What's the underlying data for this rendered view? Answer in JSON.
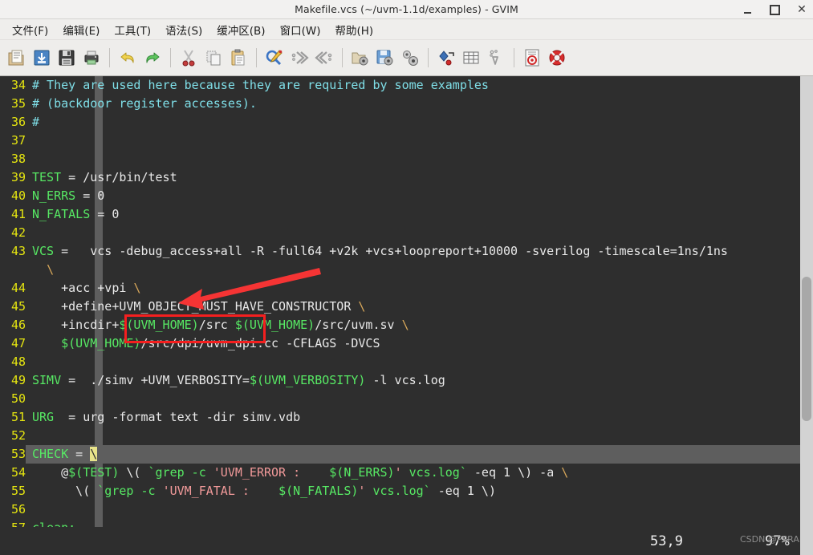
{
  "window": {
    "title": "Makefile.vcs (~/uvm-1.1d/examples) - GVIM",
    "minimize_label": "",
    "maximize_label": "",
    "close_label": "✕"
  },
  "menubar": {
    "items": [
      {
        "label": "文件(F)",
        "name": "menu-file"
      },
      {
        "label": "编辑(E)",
        "name": "menu-edit"
      },
      {
        "label": "工具(T)",
        "name": "menu-tools"
      },
      {
        "label": "语法(S)",
        "name": "menu-syntax"
      },
      {
        "label": "缓冲区(B)",
        "name": "menu-buffers"
      },
      {
        "label": "窗口(W)",
        "name": "menu-window"
      },
      {
        "label": "帮助(H)",
        "name": "menu-help"
      }
    ]
  },
  "toolbar": {
    "buttons": [
      {
        "name": "open-file-icon",
        "tip": "Open"
      },
      {
        "name": "save-file-icon",
        "tip": "Save"
      },
      {
        "name": "save-all-icon",
        "tip": "Save All"
      },
      {
        "name": "print-icon",
        "tip": "Print"
      },
      {
        "name": "undo-icon",
        "tip": "Undo"
      },
      {
        "name": "redo-icon",
        "tip": "Redo"
      },
      {
        "name": "cut-icon",
        "tip": "Cut"
      },
      {
        "name": "copy-icon",
        "tip": "Copy"
      },
      {
        "name": "paste-icon",
        "tip": "Paste"
      },
      {
        "name": "find-icon",
        "tip": "Find"
      },
      {
        "name": "find-next-icon",
        "tip": "Find Next"
      },
      {
        "name": "find-prev-icon",
        "tip": "Find Previous"
      },
      {
        "name": "load-session-icon",
        "tip": "Load Session"
      },
      {
        "name": "save-session-icon",
        "tip": "Save Session"
      },
      {
        "name": "run-script-icon",
        "tip": "Run Script"
      },
      {
        "name": "make-icon",
        "tip": "Make"
      },
      {
        "name": "build-tags-icon",
        "tip": "Build Tags"
      },
      {
        "name": "jump-tag-icon",
        "tip": "Jump to Tag"
      },
      {
        "name": "help-icon",
        "tip": "Help"
      },
      {
        "name": "find-help-icon",
        "tip": "Find Help"
      }
    ]
  },
  "editor": {
    "lines": [
      {
        "no": "34",
        "segs": [
          {
            "t": "# They are used here because they are required by some examples",
            "c": "c-comment"
          }
        ]
      },
      {
        "no": "35",
        "segs": [
          {
            "t": "# (backdoor register accesses).",
            "c": "c-comment"
          }
        ]
      },
      {
        "no": "36",
        "segs": [
          {
            "t": "#",
            "c": "c-comment"
          }
        ]
      },
      {
        "no": "37",
        "segs": []
      },
      {
        "no": "38",
        "segs": []
      },
      {
        "no": "39",
        "segs": [
          {
            "t": "TEST",
            "c": "c-ident"
          },
          {
            "t": " = /usr/bin/test",
            "c": "c-plain"
          }
        ]
      },
      {
        "no": "40",
        "segs": [
          {
            "t": "N_ERRS",
            "c": "c-ident"
          },
          {
            "t": " = 0",
            "c": "c-plain"
          }
        ]
      },
      {
        "no": "41",
        "segs": [
          {
            "t": "N_FATALS",
            "c": "c-ident"
          },
          {
            "t": " = 0",
            "c": "c-plain"
          }
        ]
      },
      {
        "no": "42",
        "segs": []
      },
      {
        "no": "43",
        "tall": true,
        "segs": [
          {
            "t": "VCS",
            "c": "c-ident"
          },
          {
            "t": " =   vcs -debug_access+all -R -full64 +v2k +vcs+loopreport+10000 -sverilog -timescale=1ns/1ns\n  ",
            "c": "c-plain"
          },
          {
            "t": "\\",
            "c": "c-cont"
          }
        ]
      },
      {
        "no": "44",
        "segs": [
          {
            "t": "    +acc +vpi ",
            "c": "c-plain"
          },
          {
            "t": "\\",
            "c": "c-cont"
          }
        ]
      },
      {
        "no": "45",
        "segs": [
          {
            "t": "    +define+UVM_OBJECT_MUST_HAVE_CONSTRUCTOR ",
            "c": "c-plain"
          },
          {
            "t": "\\",
            "c": "c-cont"
          }
        ]
      },
      {
        "no": "46",
        "segs": [
          {
            "t": "    +incdir+",
            "c": "c-plain"
          },
          {
            "t": "$(UVM_HOME)",
            "c": "c-ident"
          },
          {
            "t": "/src ",
            "c": "c-plain"
          },
          {
            "t": "$(UVM_HOME)",
            "c": "c-ident"
          },
          {
            "t": "/src/uvm.sv ",
            "c": "c-plain"
          },
          {
            "t": "\\",
            "c": "c-cont"
          }
        ]
      },
      {
        "no": "47",
        "segs": [
          {
            "t": "    ",
            "c": "c-plain"
          },
          {
            "t": "$(UVM_HOME)",
            "c": "c-ident"
          },
          {
            "t": "/src/dpi/uvm_dpi.cc -CFLAGS -DVCS",
            "c": "c-plain"
          }
        ]
      },
      {
        "no": "48",
        "segs": []
      },
      {
        "no": "49",
        "segs": [
          {
            "t": "SIMV",
            "c": "c-ident"
          },
          {
            "t": " =  ./simv +UVM_VERBOSITY=",
            "c": "c-plain"
          },
          {
            "t": "$(UVM_VERBOSITY)",
            "c": "c-ident"
          },
          {
            "t": " -l vcs.log",
            "c": "c-plain"
          }
        ]
      },
      {
        "no": "50",
        "segs": []
      },
      {
        "no": "51",
        "segs": [
          {
            "t": "URG",
            "c": "c-ident"
          },
          {
            "t": "  = urg -format text -dir simv.vdb",
            "c": "c-plain"
          }
        ]
      },
      {
        "no": "52",
        "segs": []
      },
      {
        "no": "53",
        "cursorline": true,
        "segs": [
          {
            "t": "CHECK",
            "c": "c-ident"
          },
          {
            "t": " = ",
            "c": "c-plain"
          },
          {
            "t": "\\",
            "c": "c-cursor"
          }
        ]
      },
      {
        "no": "54",
        "segs": [
          {
            "t": "    @",
            "c": "c-plain"
          },
          {
            "t": "$(TEST)",
            "c": "c-ident"
          },
          {
            "t": " \\( ",
            "c": "c-plain"
          },
          {
            "t": "`grep -c ",
            "c": "c-ident"
          },
          {
            "t": "'UVM_ERROR :    ",
            "c": "c-str"
          },
          {
            "t": "$(N_ERRS)",
            "c": "c-ident"
          },
          {
            "t": "'",
            "c": "c-str"
          },
          {
            "t": " vcs.log` ",
            "c": "c-ident"
          },
          {
            "t": "-eq 1 \\) -a ",
            "c": "c-plain"
          },
          {
            "t": "\\",
            "c": "c-cont"
          }
        ]
      },
      {
        "no": "55",
        "segs": [
          {
            "t": "      \\( ",
            "c": "c-plain"
          },
          {
            "t": "`grep -c ",
            "c": "c-ident"
          },
          {
            "t": "'UVM_FATAL :    ",
            "c": "c-str"
          },
          {
            "t": "$(N_FATALS)",
            "c": "c-ident"
          },
          {
            "t": "'",
            "c": "c-str"
          },
          {
            "t": " vcs.log` ",
            "c": "c-ident"
          },
          {
            "t": "-eq 1 \\)",
            "c": "c-plain"
          }
        ]
      },
      {
        "no": "56",
        "segs": []
      },
      {
        "no": "57",
        "segs": [
          {
            "t": "clean:",
            "c": "c-ident"
          }
        ]
      }
    ]
  },
  "statusbar": {
    "ruler": "53,9",
    "percent": "97%",
    "watermark": "CSDN @PPRAM"
  },
  "annotations": {
    "highlight_box_color": "#f51f1f",
    "arrow_color": "#f53434",
    "highlighted_text": "-debug_access+all"
  }
}
